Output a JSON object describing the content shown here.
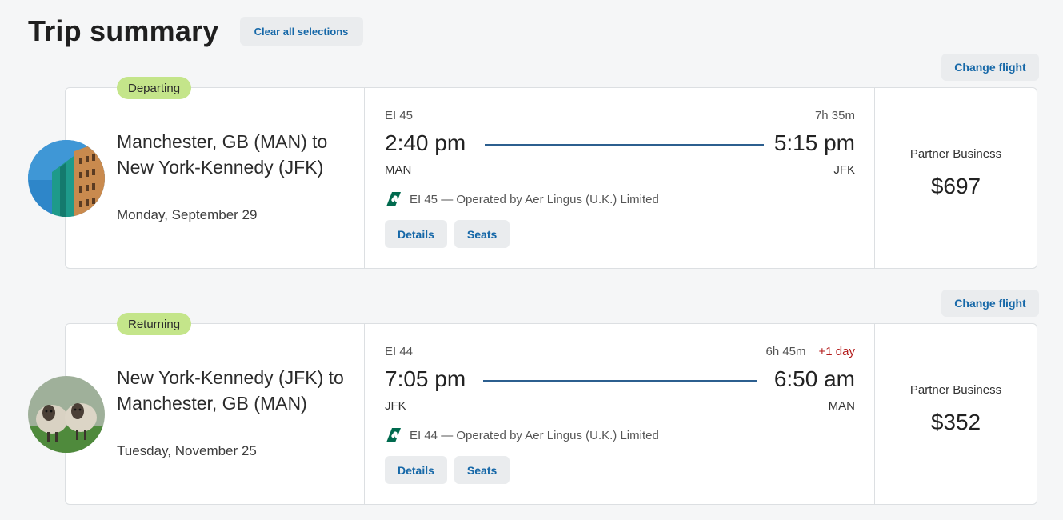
{
  "header": {
    "title": "Trip summary",
    "clear_label": "Clear all selections"
  },
  "flights": [
    {
      "change_label": "Change flight",
      "badge": "Departing",
      "image": "city-buildings",
      "route": "Manchester, GB (MAN) to New York-Kennedy (JFK)",
      "date": "Monday, September 29",
      "flight_number": "EI 45",
      "duration": "7h 35m",
      "depart_time": "2:40 pm",
      "arrive_time": "5:15 pm",
      "depart_code": "MAN",
      "arrive_code": "JFK",
      "operated_by": "EI 45 — Operated by Aer Lingus (U.K.) Limited",
      "details_label": "Details",
      "seats_label": "Seats",
      "fare_class": "Partner Business",
      "price": "$697"
    },
    {
      "change_label": "Change flight",
      "badge": "Returning",
      "image": "sheep",
      "route": "New York-Kennedy (JFK) to Manchester, GB (MAN)",
      "date": "Tuesday, November 25",
      "flight_number": "EI 44",
      "duration": "6h 45m",
      "day_offset": "+1 day",
      "depart_time": "7:05 pm",
      "arrive_time": "6:50 am",
      "depart_code": "JFK",
      "arrive_code": "MAN",
      "operated_by": "EI 44 — Operated by Aer Lingus (U.K.) Limited",
      "details_label": "Details",
      "seats_label": "Seats",
      "fare_class": "Partner Business",
      "price": "$352"
    }
  ],
  "colors": {
    "accent": "#1668a8",
    "badge": "#c4e58a",
    "line": "#2c5f8f",
    "alert": "#b31b1b"
  }
}
